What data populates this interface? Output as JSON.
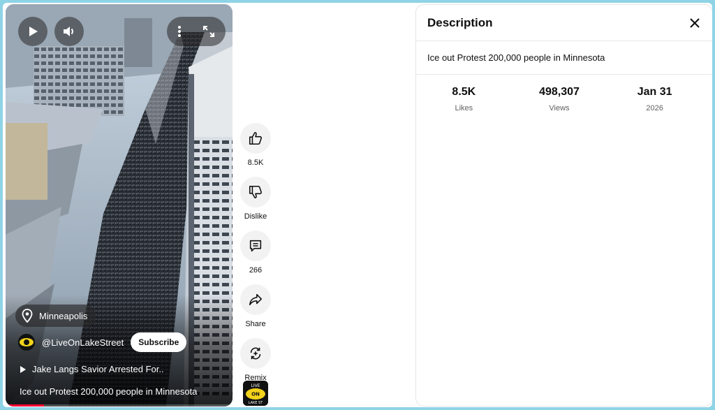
{
  "player": {
    "location": "Minneapolis",
    "channel_handle": "@LiveOnLakeStreet",
    "subscribe_label": "Subscribe",
    "linked_video_title": "Jake Langs Savior Arrested For..",
    "video_title": "Ice out Protest 200,000 people in Minnesota",
    "progress": 0.17,
    "accent_color": "#ff0033",
    "icons": [
      "play-icon",
      "volume-icon",
      "more-vert-icon",
      "fullscreen-icon",
      "location-pin-icon"
    ]
  },
  "actions": [
    {
      "icon": "thumb-up-icon",
      "label": "8.5K"
    },
    {
      "icon": "thumb-down-icon",
      "label": "Dislike"
    },
    {
      "icon": "comment-icon",
      "label": "266"
    },
    {
      "icon": "share-icon",
      "label": "Share"
    },
    {
      "icon": "remix-icon",
      "label": "Remix"
    }
  ],
  "description": {
    "title": "Description",
    "text": "Ice out Protest 200,000 people in Minnesota",
    "stats": [
      {
        "value": "8.5K",
        "label": "Likes"
      },
      {
        "value": "498,307",
        "label": "Views"
      },
      {
        "value": "Jan 31",
        "label": "2026"
      }
    ]
  },
  "channel_logo_text": [
    "LIVE",
    "ON",
    "LAKE ST"
  ]
}
